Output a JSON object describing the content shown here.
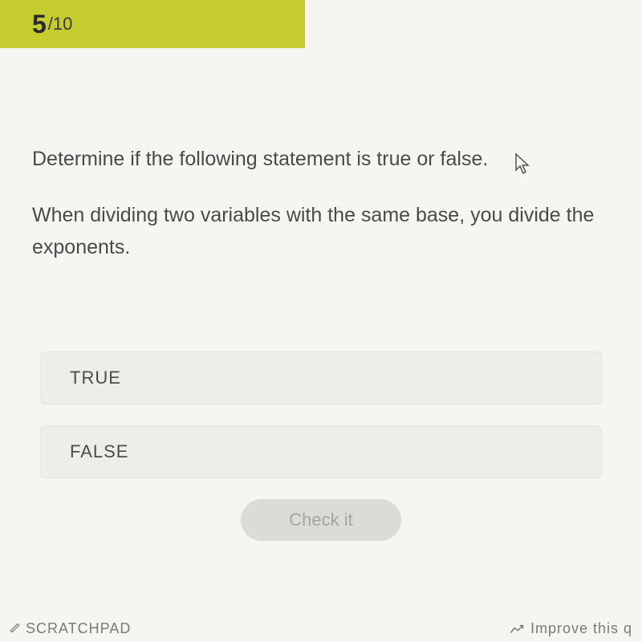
{
  "progress": {
    "current": "5",
    "total": "/10"
  },
  "question": {
    "prompt": "Determine if the following statement is true or false.",
    "statement": "When dividing two variables with the same base, you divide the exponents."
  },
  "options": {
    "true_label": "TRUE",
    "false_label": "FALSE"
  },
  "actions": {
    "check": "Check it"
  },
  "footer": {
    "scratchpad": "SCRATCHPAD",
    "improve": "Improve this q"
  }
}
